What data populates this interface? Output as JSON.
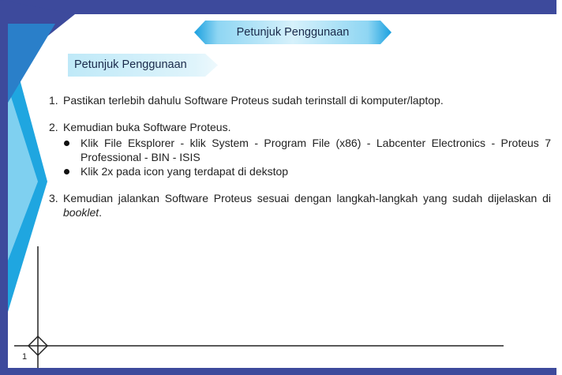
{
  "header": {
    "banner_title": "Petunjuk Penggunaan",
    "section_label": "Petunjuk Penggunaan"
  },
  "steps": [
    {
      "number": "1.",
      "text": "Pastikan terlebih dahulu Software Proteus sudah terinstall di komputer/laptop."
    },
    {
      "number": "2.",
      "text": "Kemudian buka Software Proteus.",
      "bullets": [
        "Klik File Eksplorer - klik System - Program File (x86) - Labcenter Electronics - Proteus 7 Professional - BIN - ISIS",
        "Klik 2x pada icon yang terdapat di dekstop"
      ]
    },
    {
      "number": "3.",
      "text_before_italic": "Kemudian jalankan Software Proteus sesuai dengan langkah-langkah yang sudah dijelaskan di ",
      "text_italic": "booklet",
      "text_after_italic": "."
    }
  ],
  "footer": {
    "page_number": "1"
  },
  "colors": {
    "frame_navy": "#3d4a9c",
    "accent_blue": "#1fa6e0",
    "light_cyan": "#bfe9f8"
  }
}
